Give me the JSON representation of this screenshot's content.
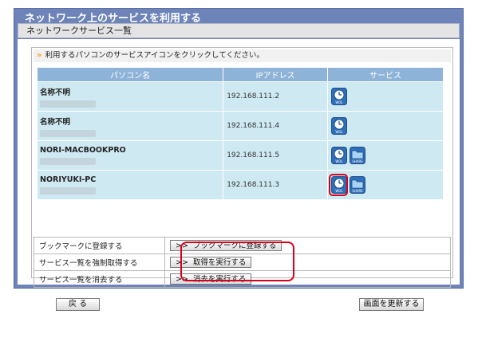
{
  "page": {
    "title": "ネットワーク上のサービスを利用する",
    "section": "ネットワークサービス一覧",
    "instruction": "利用するパソコンのサービスアイコンをクリックしてください。"
  },
  "table": {
    "headers": [
      "パソコン名",
      "IPアドレス",
      "サービス"
    ],
    "rows": [
      {
        "name": "名称不明",
        "ip": "192.168.111.2",
        "services": [
          "WOL"
        ]
      },
      {
        "name": "名称不明",
        "ip": "192.168.111.4",
        "services": [
          "WOL"
        ]
      },
      {
        "name": "NORI-MACBOOKPRO",
        "ip": "192.168.111.5",
        "services": [
          "WOL",
          "SHARE"
        ]
      },
      {
        "name": "NORIYUKI-PC",
        "ip": "192.168.111.3",
        "services": [
          "WOL",
          "SHARE"
        ]
      }
    ]
  },
  "actions": [
    {
      "label": "ブックマークに登録する",
      "button": "ブックマークに登録する"
    },
    {
      "label": "サービス一覧を強制取得する",
      "button": "取得を実行する"
    },
    {
      "label": "サービス一覧を消去する",
      "button": "消去を実行する"
    }
  ],
  "chevron": ">>",
  "footer": {
    "back": "戻 る",
    "refresh": "画面を更新する"
  },
  "icons": {
    "wol": "clock-icon",
    "share": "folder-icon"
  },
  "colors": {
    "panel": "#6e84b8",
    "header_cell": "#8eb3d8",
    "row_cell": "#cfe9f3",
    "highlight": "#d9001b"
  }
}
